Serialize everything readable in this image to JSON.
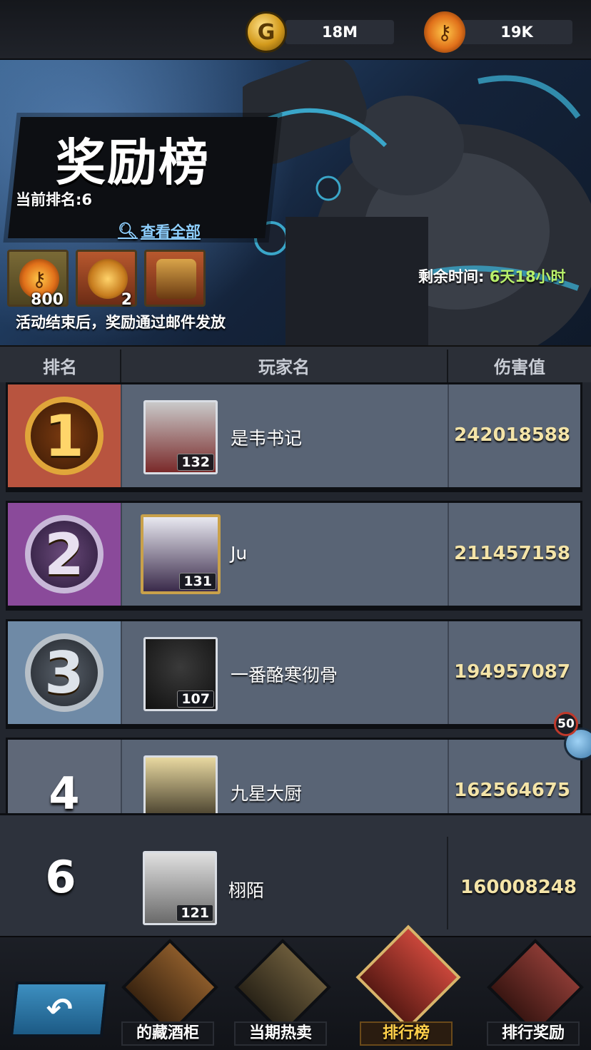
{
  "currency": {
    "gold": {
      "icon": "gold-coin-icon",
      "value": "18M"
    },
    "key": {
      "icon": "flame-key-icon",
      "value": "19K"
    }
  },
  "banner": {
    "title": "奖励榜",
    "current_rank": "当前排名:6",
    "view_all": "查看全部",
    "remaining_label": "剩余时间:",
    "remaining_value": "6天18小时",
    "mail_note": "活动结束后，奖励通过邮件发放",
    "rewards": [
      {
        "icon": "flame-key-icon",
        "count": "800"
      },
      {
        "icon": "golden-scroll-icon",
        "count": "2"
      },
      {
        "icon": "mystery-chest-icon",
        "count": ""
      }
    ]
  },
  "table": {
    "headers": [
      "排名",
      "玩家名",
      "伤害值"
    ],
    "rows": [
      {
        "rank": "1",
        "name": "是韦书记",
        "level": "132",
        "damage": "242018588"
      },
      {
        "rank": "2",
        "name": "Ju",
        "level": "131",
        "damage": "211457158"
      },
      {
        "rank": "3",
        "name": "一番酪寒彻骨",
        "level": "107",
        "damage": "194957087"
      },
      {
        "rank": "4",
        "name": "九星大厨",
        "level": "",
        "damage": "162564675"
      }
    ]
  },
  "self": {
    "rank": "6",
    "name": "栩陌",
    "level": "121",
    "damage": "160008248"
  },
  "chat_badge": "50",
  "nav": {
    "items": [
      {
        "label": "的藏酒柜",
        "active": false
      },
      {
        "label": "当期热卖",
        "active": false
      },
      {
        "label": "排行榜",
        "active": true
      },
      {
        "label": "排行奖励",
        "active": false
      }
    ]
  },
  "colors": {
    "rank1_bg": "#b8543f",
    "rank2_bg": "#8a4a9a",
    "rank3_bg": "#6f8aa6",
    "rank4_bg": "#5f6878",
    "damage": "#f4e4a8",
    "time_value": "#b9f06a",
    "view_all": "#8fd0ff"
  }
}
